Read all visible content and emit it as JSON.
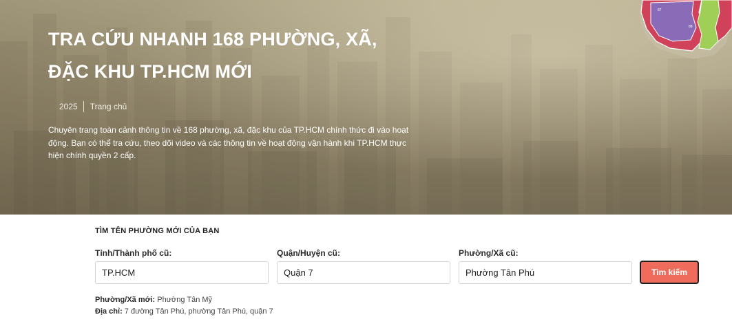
{
  "hero": {
    "title_line1": "TRA CỨU NHANH 168 PHƯỜNG, XÃ,",
    "title_line2": "ĐẶC KHU TP.HCM MỚI",
    "year": "2025",
    "home_link": "Trang chủ",
    "description": "Chuyên trang toàn cảnh thông tin về 168 phường, xã, đặc khu của TP.HCM chính thức đi vào hoạt động. Bạn có thể tra cứu, theo dõi video và các thông tin về hoạt động vận hành khi TP.HCM thực hiện chính quyền 2 cấp.",
    "map_labels": [
      "87",
      "88"
    ]
  },
  "lookup": {
    "heading": "TÌM TÊN PHƯỜNG MỚI CỦA BẠN",
    "province_label": "Tỉnh/Thành phố cũ:",
    "province_value": "TP.HCM",
    "district_label": "Quận/Huyện cũ:",
    "district_value": "Quận 7",
    "ward_label": "Phường/Xã cũ:",
    "ward_value": "Phường Tân Phú",
    "search_button": "Tìm kiếm"
  },
  "result": {
    "new_ward_label": "Phường/Xã mới:",
    "new_ward_value": "Phường Tân Mỹ",
    "address_label": "Địa chỉ:",
    "address_value": "7 đường Tân Phú, phường Tân Phú, quận 7"
  },
  "colors": {
    "accent": "#ef6b5b",
    "hero_text": "#ffffff",
    "map_red": "#d0425a",
    "map_purple": "#8a6bb8",
    "map_green": "#9fcf56"
  },
  "icons": [
    "district-map-graphic"
  ]
}
